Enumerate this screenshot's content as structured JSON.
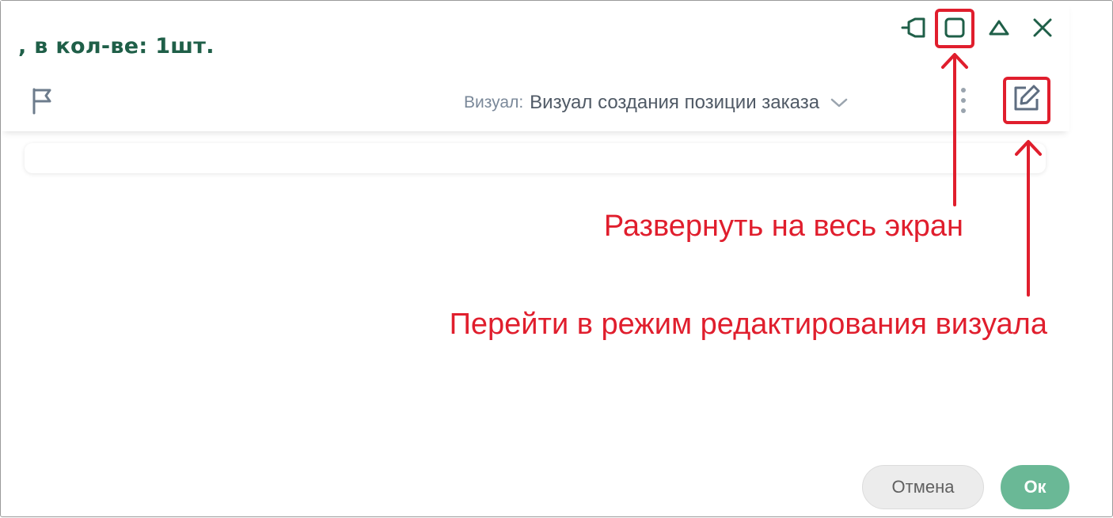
{
  "dialog": {
    "title": ", в кол-ве: 1шт."
  },
  "toolbar": {
    "visual_label": "Визуал:",
    "visual_value": "Визуал создания позиции заказа"
  },
  "annotations": {
    "maximize_hint": "Развернуть на весь экран",
    "edit_hint": "Перейти в режим редактирования визуала"
  },
  "footer": {
    "cancel_label": "Отмена",
    "ok_label": "Ок"
  },
  "colors": {
    "title": "#1f5f48",
    "icons": "#1f5f48",
    "annotation": "#e01e2d",
    "ok_button": "#6ab896"
  },
  "icons": [
    "pin-icon",
    "maximize-icon",
    "collapse-icon",
    "close-icon",
    "flag-icon",
    "chevron-down-icon",
    "kebab-menu-icon",
    "edit-icon"
  ]
}
